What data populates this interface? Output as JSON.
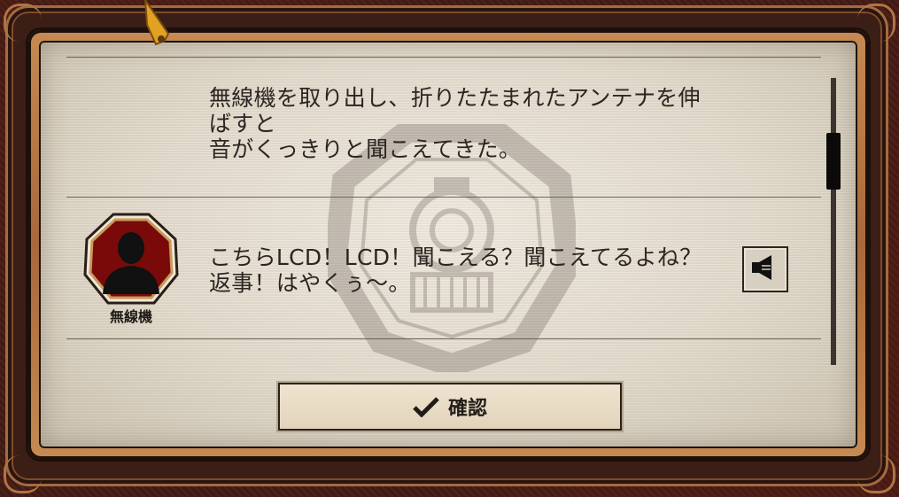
{
  "dialog": {
    "messages": [
      {
        "speaker": "",
        "text": "無線機を取り出し、折りたたまれたアンテナを伸\nばすと\n音がくっきりと聞こえてきた。"
      },
      {
        "speaker": "無線機",
        "text": "こちらLCD！LCD！聞こえる？聞こえてるよね？\n返事！はやくぅ～。",
        "has_voice": true
      }
    ],
    "confirm_label": "確認",
    "confirm_icon": "checkmark-icon",
    "speaker_icon": "speaker-icon"
  },
  "colors": {
    "frame": "#3b1e16",
    "copper": "#c68a52",
    "paper": "#e4dccd",
    "text": "#2b2622",
    "avatar_bg": "#7a0a0a"
  }
}
